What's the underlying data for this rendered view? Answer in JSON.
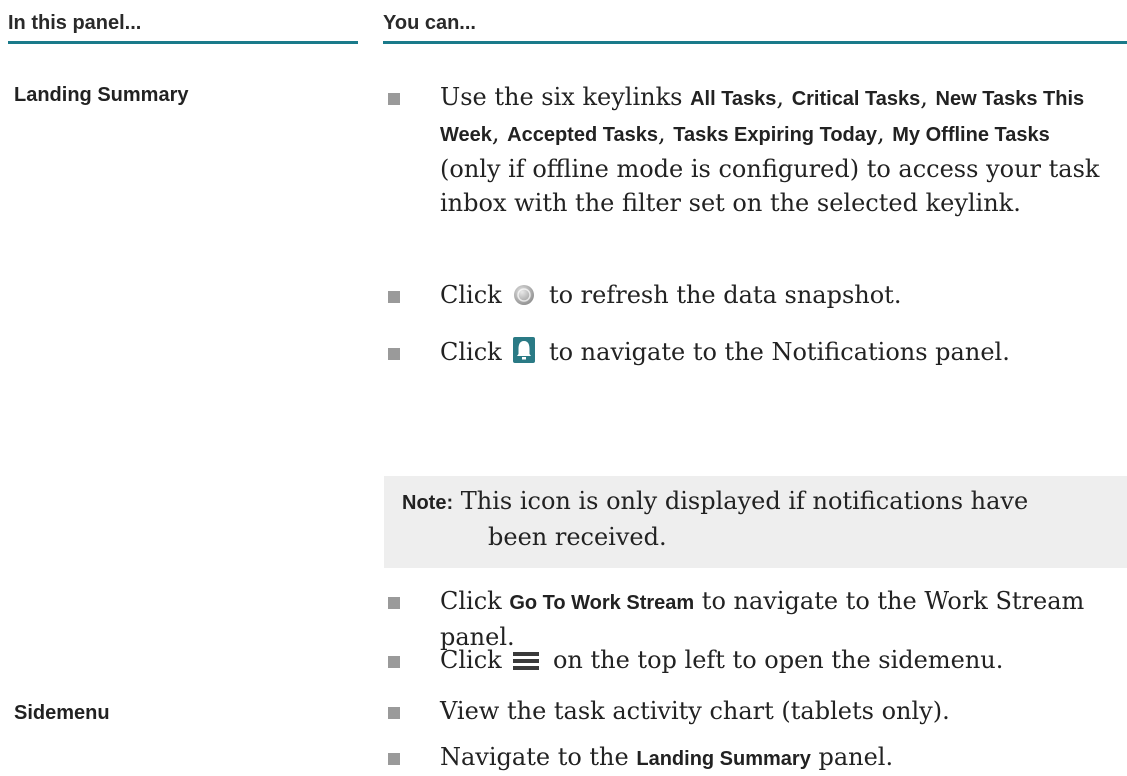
{
  "table": {
    "header_left": "In this panel...",
    "header_right": "You can...",
    "accent_color": "#1a7a8a"
  },
  "landing": {
    "panel_name": "Landing Summary",
    "b1": {
      "t1": "Use the six keylinks ",
      "k1": "All Tasks",
      "t2": ", ",
      "k2": "Critical Tasks",
      "t3": ", ",
      "k3": "New Tasks This Week",
      "t4": ", ",
      "k4": "Accepted Tasks",
      "t5": ", ",
      "k5": "Tasks Expiring Today",
      "t6": ", ",
      "k6": "My Offline Tasks",
      "t7": " (only if offline mode is configured) to access your task inbox with the filter set on the selected keylink."
    },
    "b2": {
      "t1": "Click ",
      "t2": " to refresh the data snapshot.",
      "icon": "refresh-icon"
    },
    "b3": {
      "t1": "Click ",
      "t2": " to navigate to the Notifications panel.",
      "icon": "bell-icon"
    },
    "note": {
      "label": "Note:",
      "line1": " This icon is only displayed if notifications have",
      "line2": "been received."
    },
    "b4": {
      "t1": "Click ",
      "k1": "Go To Work Stream",
      "t2": " to navigate to the Work Stream panel."
    },
    "b5": {
      "t1": "Click ",
      "t2": " on the top left to open the sidemenu.",
      "icon": "menu-icon"
    },
    "b6": {
      "t1": "View the task activity chart (tablets only)."
    }
  },
  "sidemenu": {
    "panel_name": "Sidemenu",
    "b1": {
      "t1": "Navigate to the ",
      "k1": "Landing Summary",
      "t2": " panel."
    }
  }
}
